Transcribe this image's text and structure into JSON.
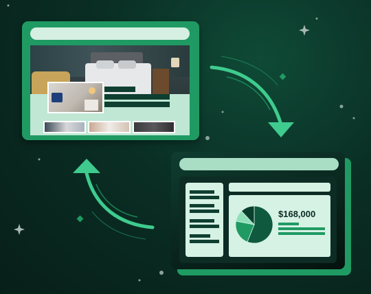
{
  "illustration": {
    "description_kind": "conversion flow illustration",
    "colors": {
      "background": "#0a2e24",
      "accent_green": "#1f9a63",
      "arrow": "#3fcb8e",
      "panel_light": "#d6f2e4",
      "dark_text": "#0f3f31"
    }
  },
  "listing_card": {
    "icon": "browser-window-icon"
  },
  "dashboard_card": {
    "price_label": "$168,000",
    "pie_chart": {
      "type": "pie",
      "slices": [
        0.56,
        0.22,
        0.1,
        0.12
      ],
      "colors": [
        "#0f5a3e",
        "#1f9a63",
        "#8fe0b9",
        "#0a3f2e"
      ]
    }
  },
  "arrows": {
    "forward_icon": "curved-arrow-down-icon",
    "back_icon": "curved-arrow-up-icon"
  },
  "decorations": {
    "sparkle_icon": "sparkle-icon"
  }
}
